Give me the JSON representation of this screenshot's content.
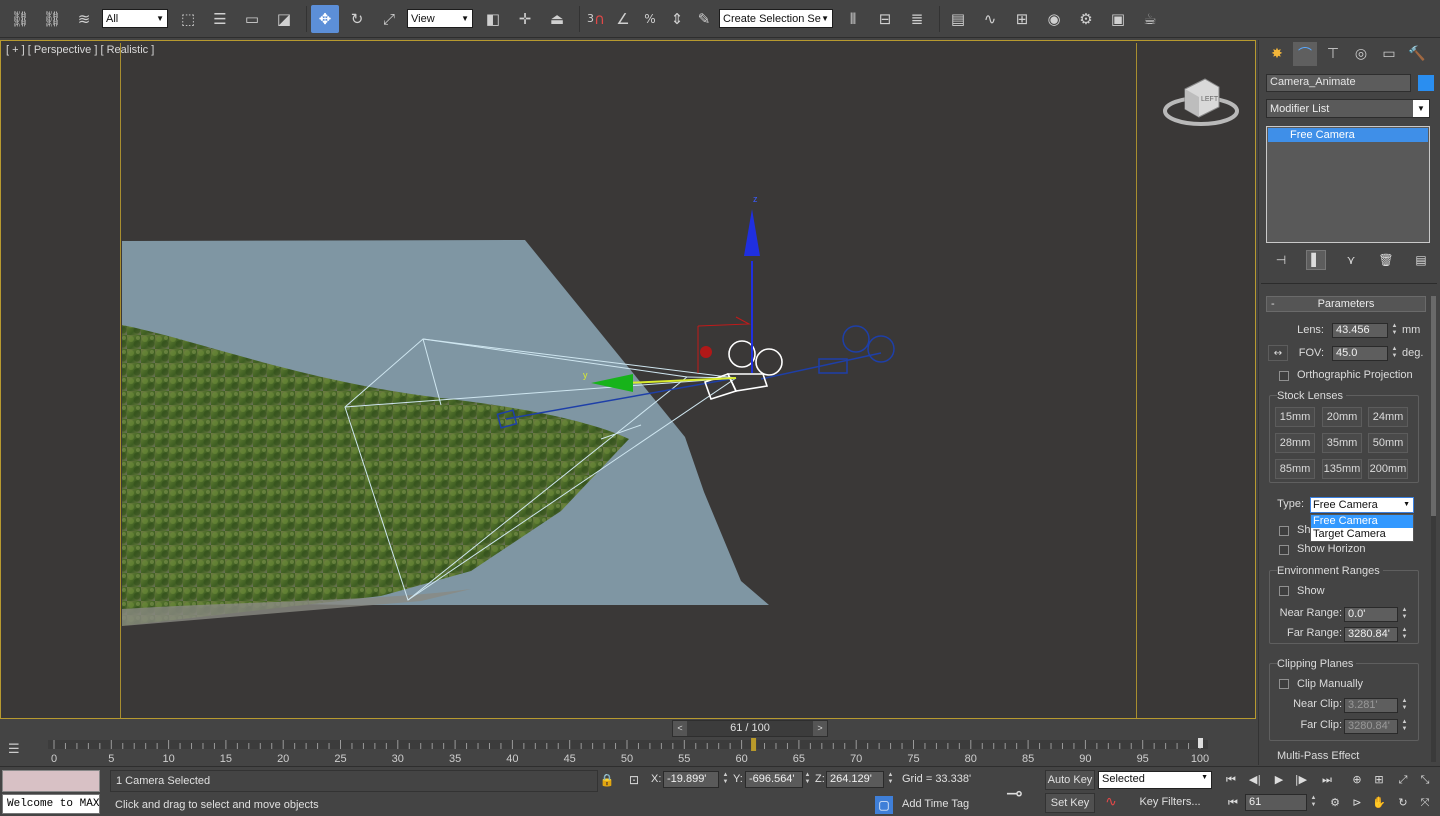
{
  "toolbar": {
    "filter": "All",
    "ref_coord": "View",
    "snap_label": "3",
    "percent_label": "%",
    "named_selection": "Create Selection Se",
    "icons": [
      "link-icon",
      "unlink-icon",
      "bind-spacewarp-icon",
      "select-object-icon",
      "select-by-name-icon",
      "rect-region-icon",
      "window-crossing-icon",
      "move-icon",
      "rotate-icon",
      "scale-icon",
      "use-pivot-icon",
      "manipulate-icon",
      "keyboard-shortcut-icon",
      "snap-toggle-icon",
      "angle-snap-icon",
      "percent-snap-icon",
      "spinner-snap-icon",
      "edit-named-sel-icon",
      "mirror-icon",
      "align-icon",
      "layer-manager-icon",
      "ribbon-icon",
      "curve-editor-icon",
      "schematic-view-icon",
      "material-editor-icon",
      "render-setup-icon",
      "rendered-frame-icon",
      "render-icon"
    ]
  },
  "viewport": {
    "label": "[ + ] [ Perspective ] [ Realistic ]",
    "axis_y": "y",
    "axis_z": "z",
    "viewcube_face": "LEFT"
  },
  "command_panel": {
    "tabs": [
      "create-icon",
      "modify-icon",
      "hierarchy-icon",
      "motion-icon",
      "display-icon",
      "utilities-icon"
    ],
    "object_name": "Camera_Animate",
    "object_color": "#2a8ef0",
    "modifier_list": "Modifier List",
    "stack_item": "Free Camera",
    "rollout_title": "Parameters",
    "lens_label": "Lens:",
    "lens_value": "43.456",
    "lens_unit": "mm",
    "fov_label": "FOV:",
    "fov_value": "45.0",
    "fov_unit": "deg.",
    "ortho_label": "Orthographic Projection",
    "stock_lenses_title": "Stock Lenses",
    "stock_lenses": [
      "15mm",
      "20mm",
      "24mm",
      "28mm",
      "35mm",
      "50mm",
      "85mm",
      "135mm",
      "200mm"
    ],
    "type_label": "Type:",
    "type_value": "Free Camera",
    "type_options": [
      "Free Camera",
      "Target Camera"
    ],
    "show_cone_partial": "Sh",
    "show_horizon": "Show Horizon",
    "env_title": "Environment Ranges",
    "env_show": "Show",
    "near_range_label": "Near Range:",
    "near_range_value": "0.0'",
    "far_range_label": "Far Range:",
    "far_range_value": "3280.84'",
    "clip_title": "Clipping Planes",
    "clip_manual": "Clip Manually",
    "near_clip_label": "Near Clip:",
    "near_clip_value": "3.281'",
    "far_clip_label": "Far Clip:",
    "far_clip_value": "3280.84'",
    "multipass_partial": "Multi-Pass Effect"
  },
  "timeline": {
    "slider_label": "61 / 100",
    "current_frame": 61,
    "ticks": [
      "0",
      "5",
      "10",
      "15",
      "20",
      "25",
      "30",
      "35",
      "40",
      "45",
      "50",
      "55",
      "60",
      "65",
      "70",
      "75",
      "80",
      "85",
      "90",
      "95",
      "100"
    ]
  },
  "status": {
    "listener": "Welcome to MAXScript.",
    "selection": "1 Camera Selected",
    "prompt": "Click and drag to select and move objects",
    "x_label": "X:",
    "x_value": "-19.899'",
    "y_label": "Y:",
    "y_value": "-696.564'",
    "z_label": "Z:",
    "z_value": "264.129'",
    "grid": "Grid = 33.338'",
    "add_time_tag": "Add Time Tag",
    "auto_key": "Auto Key",
    "set_key": "Set Key",
    "key_mode": "Selected",
    "key_filters": "Key Filters...",
    "frame": "61"
  }
}
